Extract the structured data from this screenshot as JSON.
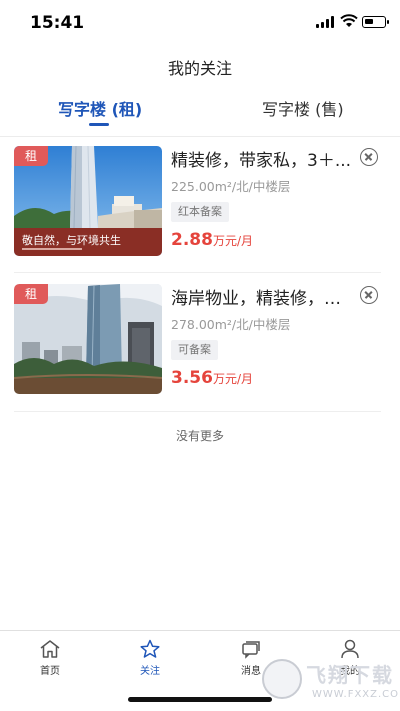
{
  "status_bar": {
    "time": "15:41"
  },
  "header": {
    "title": "我的关注"
  },
  "tabs": [
    {
      "label": "写字楼 (租)",
      "active": true
    },
    {
      "label": "写字楼 (售)",
      "active": false
    }
  ],
  "listings": [
    {
      "tag": "租",
      "title": "精装修，带家私，3＋...",
      "meta": "225.00m²/北/中楼层",
      "badge": "红本备案",
      "price": "2.88",
      "price_unit": "万元/月",
      "image_caption": "敬自然，与环境共生"
    },
    {
      "tag": "租",
      "title": "海岸物业，精装修，带...",
      "meta": "278.00m²/北/中楼层",
      "badge": "可备案",
      "price": "3.56",
      "price_unit": "万元/月"
    }
  ],
  "list_footer": "没有更多",
  "bottom_nav": [
    {
      "label": "首页",
      "icon": "home-icon",
      "active": false
    },
    {
      "label": "关注",
      "icon": "star-icon",
      "active": true
    },
    {
      "label": "消息",
      "icon": "message-icon",
      "active": false
    },
    {
      "label": "我的",
      "icon": "user-icon",
      "active": false
    }
  ],
  "watermark": {
    "text": "飞翔下载",
    "url": "WWW.FXXZ.COM"
  },
  "colors": {
    "accent": "#1f56b8",
    "price": "#e5443c",
    "tag": "#e05a5a"
  }
}
